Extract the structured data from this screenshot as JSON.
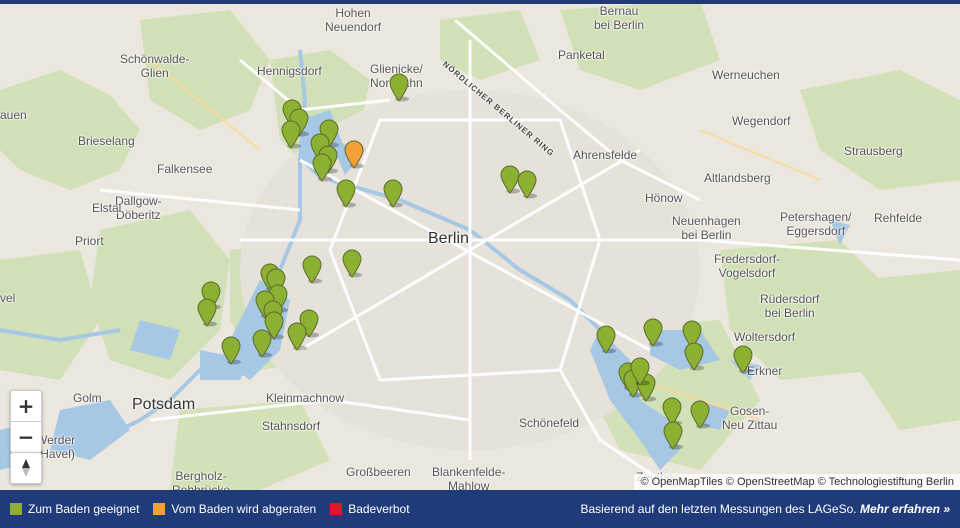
{
  "map": {
    "labels": {
      "hohen_neuendorf": "Hohen\nNeuendorf",
      "bernau": "Bernau\nbei Berlin",
      "schoenwalde": "Schönwalde-\nGlien",
      "hennigsdorf": "Hennigsdorf",
      "glienicke": "Glienicke/\nNordbahn",
      "panketal": "Panketal",
      "werneuchen": "Werneuchen",
      "ring": "NÖRDLICHER BERLINER RING",
      "brieselang": "Brieselang",
      "wegendorf": "Wegendorf",
      "ahrensfelde": "Ahrensfelde",
      "strausberg": "Strausberg",
      "falkensee": "Falkensee",
      "altlandsberg": "Altlandsberg",
      "dallgow": "Dallgow-\nDöberitz",
      "hoenow": "Hönow",
      "elstal": "Elstal",
      "petershagen": "Petershagen/\nEggersdorf",
      "rehfelde": "Rehfelde",
      "neuenhagen": "Neuenhagen\nbei Berlin",
      "priort": "Priort",
      "berlin": "Berlin",
      "fredersdorf": "Fredersdorf-\nVogelsdorf",
      "ruedersdorf": "Rüdersdorf\nbei Berlin",
      "woltersdorf": "Woltersdorf",
      "erkner": "Erkner",
      "golm": "Golm",
      "potsdam": "Potsdam",
      "kleinmachnow": "Kleinmachnow",
      "gosen": "Gosen-\nNeu Zittau",
      "stahnsdorf": "Stahnsdorf",
      "schoenefeld": "Schönefeld",
      "werder": "Werder\n(Havel)",
      "bergholz": "Bergholz-\nRehbrücke",
      "grossbeeren": "Großbeeren",
      "blankenfelde": "Blankenfelde-\nMahlow",
      "zeuthen": "Zeuthen",
      "auen": "auen",
      "vel": "vel"
    },
    "markers": [
      {
        "status": "ok"
      },
      {
        "status": "ok"
      },
      {
        "status": "ok"
      },
      {
        "status": "ok"
      },
      {
        "status": "ok"
      },
      {
        "status": "ok"
      },
      {
        "status": "ok"
      },
      {
        "status": "ok"
      },
      {
        "status": "ok"
      },
      {
        "status": "warn"
      },
      {
        "status": "ok"
      },
      {
        "status": "ok"
      },
      {
        "status": "ok"
      },
      {
        "status": "ok"
      },
      {
        "status": "ok"
      },
      {
        "status": "ok"
      },
      {
        "status": "ok"
      },
      {
        "status": "ok"
      },
      {
        "status": "ok"
      },
      {
        "status": "ok"
      },
      {
        "status": "ok"
      },
      {
        "status": "ok"
      },
      {
        "status": "ok"
      },
      {
        "status": "ok"
      },
      {
        "status": "ok"
      },
      {
        "status": "ok"
      },
      {
        "status": "ok"
      },
      {
        "status": "ok"
      },
      {
        "status": "ok"
      },
      {
        "status": "ok"
      },
      {
        "status": "ok"
      },
      {
        "status": "ok"
      },
      {
        "status": "ok"
      },
      {
        "status": "ok"
      },
      {
        "status": "ok"
      },
      {
        "status": "ok"
      },
      {
        "status": "ok"
      },
      {
        "status": "ok"
      },
      {
        "status": "ok"
      }
    ],
    "colors": {
      "ok": "#8cb031",
      "warn": "#f4a03a",
      "ban": "#e2142d"
    },
    "zoom_in": "+",
    "zoom_out": "−",
    "attribution": "© OpenMapTiles © OpenStreetMap © Technologiestiftung Berlin"
  },
  "legend": {
    "items": [
      {
        "label": "Zum Baden geeignet",
        "color": "#8cb031"
      },
      {
        "label": "Vom Baden wird abgeraten",
        "color": "#f4a03a"
      },
      {
        "label": "Badeverbot",
        "color": "#e2142d"
      }
    ]
  },
  "footer": {
    "text": "Basierend auf den letzten Messungen des LAGeSo.",
    "link": "Mehr erfahren »"
  }
}
